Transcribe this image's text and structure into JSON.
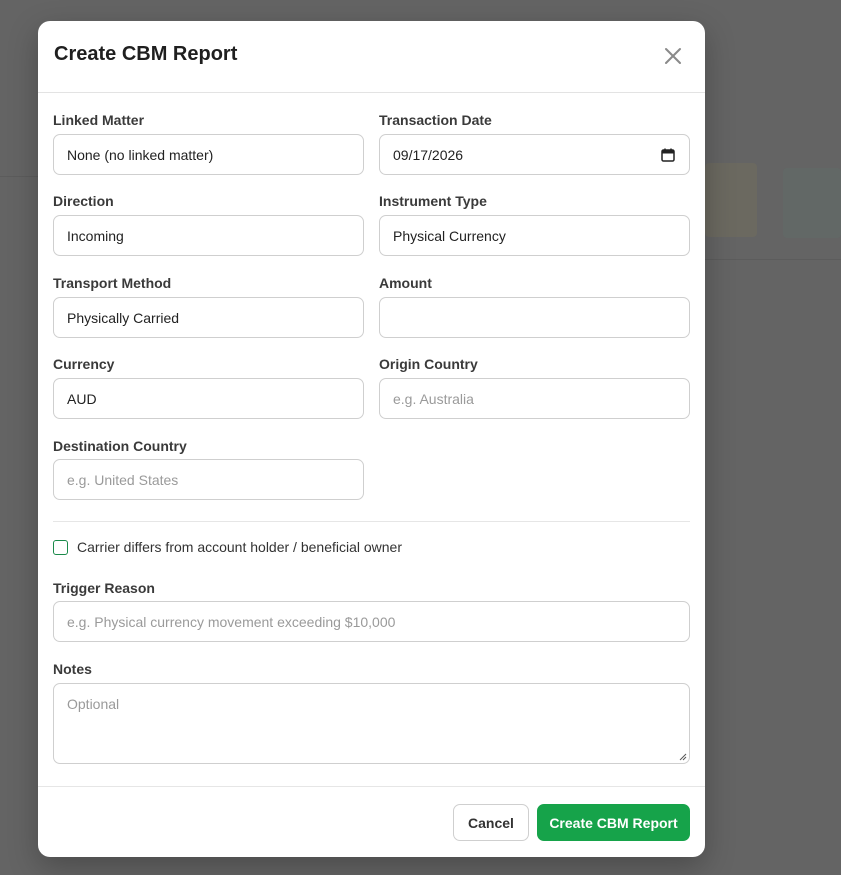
{
  "dialog": {
    "title": "Create CBM Report",
    "close_icon": "close-icon"
  },
  "fields": {
    "linked_matter": {
      "label": "Linked Matter",
      "value": "None (no linked matter)"
    },
    "transaction_date": {
      "label": "Transaction Date",
      "value": "09/17/2026",
      "icon": "calendar-icon"
    },
    "direction": {
      "label": "Direction",
      "value": "Incoming"
    },
    "instrument_type": {
      "label": "Instrument Type",
      "value": "Physical Currency"
    },
    "transport_method": {
      "label": "Transport Method",
      "value": "Physically Carried"
    },
    "amount": {
      "label": "Amount",
      "value": ""
    },
    "currency": {
      "label": "Currency",
      "value": "AUD"
    },
    "origin_country": {
      "label": "Origin Country",
      "placeholder": "e.g. Australia"
    },
    "destination_country": {
      "label": "Destination Country",
      "placeholder": "e.g. United States"
    },
    "carrier_differs": {
      "label": "Carrier differs from account holder / beneficial owner",
      "checked": false
    },
    "trigger_reason": {
      "label": "Trigger Reason",
      "placeholder": "e.g. Physical currency movement exceeding $10,000"
    },
    "notes": {
      "label": "Notes",
      "placeholder": "Optional"
    }
  },
  "buttons": {
    "cancel": "Cancel",
    "submit": "Create CBM Report"
  },
  "colors": {
    "primary": "#16a34a",
    "overlay": "#646464"
  }
}
